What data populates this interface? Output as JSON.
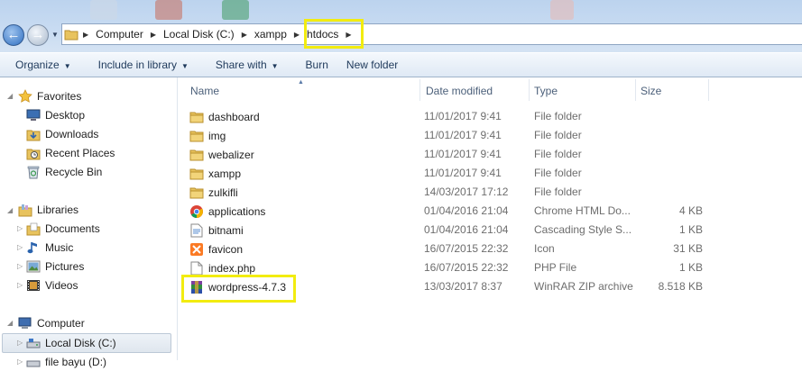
{
  "address": {
    "crumbs": [
      "Computer",
      "Local Disk (C:)",
      "xampp",
      "htdocs"
    ]
  },
  "toolbar": {
    "organize": "Organize",
    "include_in_library": "Include in library",
    "share_with": "Share with",
    "burn": "Burn",
    "new_folder": "New folder"
  },
  "nav": {
    "favorites": "Favorites",
    "desktop": "Desktop",
    "downloads": "Downloads",
    "recent_places": "Recent Places",
    "recycle_bin": "Recycle Bin",
    "libraries": "Libraries",
    "documents": "Documents",
    "music": "Music",
    "pictures": "Pictures",
    "videos": "Videos",
    "computer": "Computer",
    "local_disk": "Local Disk (C:)",
    "partial": "file bayu (D:)"
  },
  "columns": {
    "name": "Name",
    "date": "Date modified",
    "type": "Type",
    "size": "Size"
  },
  "files": [
    {
      "name": "dashboard",
      "date": "11/01/2017 9:41",
      "type": "File folder",
      "size": "",
      "icon": "folder-icon"
    },
    {
      "name": "img",
      "date": "11/01/2017 9:41",
      "type": "File folder",
      "size": "",
      "icon": "folder-icon"
    },
    {
      "name": "webalizer",
      "date": "11/01/2017 9:41",
      "type": "File folder",
      "size": "",
      "icon": "folder-icon"
    },
    {
      "name": "xampp",
      "date": "11/01/2017 9:41",
      "type": "File folder",
      "size": "",
      "icon": "folder-icon"
    },
    {
      "name": "zulkifli",
      "date": "14/03/2017 17:12",
      "type": "File folder",
      "size": "",
      "icon": "folder-icon"
    },
    {
      "name": "applications",
      "date": "01/04/2016 21:04",
      "type": "Chrome HTML Do...",
      "size": "4 KB",
      "icon": "chrome-icon"
    },
    {
      "name": "bitnami",
      "date": "01/04/2016 21:04",
      "type": "Cascading Style S...",
      "size": "1 KB",
      "icon": "css-file-icon"
    },
    {
      "name": "favicon",
      "date": "16/07/2015 22:32",
      "type": "Icon",
      "size": "31 KB",
      "icon": "xampp-icon"
    },
    {
      "name": "index.php",
      "date": "16/07/2015 22:32",
      "type": "PHP File",
      "size": "1 KB",
      "icon": "blank-file-icon"
    },
    {
      "name": "wordpress-4.7.3",
      "date": "13/03/2017 8:37",
      "type": "WinRAR ZIP archive",
      "size": "8.518 KB",
      "icon": "winrar-icon"
    }
  ],
  "colors": {
    "highlight": "#f2ec10",
    "toolbar_text": "#1e395b",
    "folder": "#e8c35e"
  }
}
